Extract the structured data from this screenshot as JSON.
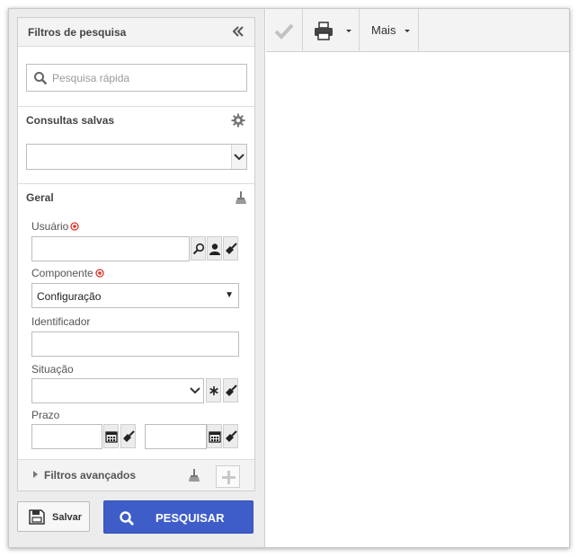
{
  "filters": {
    "title": "Filtros de pesquisa",
    "quick_search_placeholder": "Pesquisa rápida",
    "saved_queries_title": "Consultas salvas",
    "saved_query_value": "",
    "general_title": "Geral",
    "fields": {
      "user_label": "Usuário",
      "user_value": "",
      "component_label": "Componente",
      "component_value": "Configuração",
      "identifier_label": "Identificador",
      "identifier_value": "",
      "status_label": "Situação",
      "status_value": "",
      "deadline_label": "Prazo",
      "deadline_from": "",
      "deadline_to": ""
    },
    "advanced_label": "Filtros avançados"
  },
  "actions": {
    "save_label": "Salvar",
    "search_label": "PESQUISAR"
  },
  "toolbar": {
    "more_label": "Mais"
  },
  "colors": {
    "primary_button": "#3f5dc9",
    "required_marker": "#d9342b"
  }
}
